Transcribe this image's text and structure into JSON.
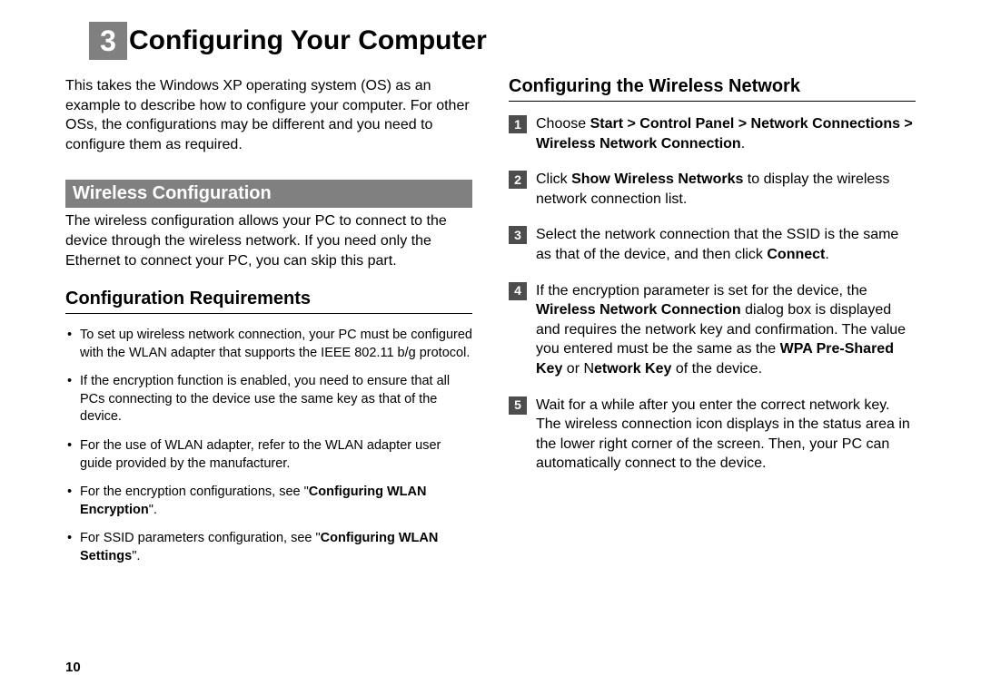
{
  "chapter": {
    "number": "3",
    "title": "Configuring Your Computer"
  },
  "intro": "This takes the Windows XP operating system (OS) as an example to describe how to configure your computer. For other OSs, the configurations may be different and you need to configure them as required.",
  "left": {
    "section_bar": "Wireless Configuration",
    "section_body": "The wireless configuration allows your PC to connect to the device through the wireless network. If you need only the Ethernet to connect your PC, you can skip this part.",
    "subhead": "Configuration Requirements",
    "bullets": {
      "b1": "To set up wireless network connection, your PC must be configured with the WLAN adapter that supports the IEEE 802.11 b/g protocol.",
      "b2": "If the encryption function is enabled, you need to ensure that all PCs connecting to the device use the same key as that of the device.",
      "b3": "For the use of WLAN adapter, refer to the WLAN adapter user guide provided by the manufacturer.",
      "b4_pre": "For the encryption configurations, see \"",
      "b4_bold": "Configuring WLAN Encryption",
      "b4_post": "\".",
      "b5_pre": "For SSID parameters configuration, see \"",
      "b5_bold": "Configuring WLAN Settings",
      "b5_post": "\"."
    }
  },
  "right": {
    "subhead": "Configuring the Wireless Network",
    "steps": {
      "s1_pre": "Choose ",
      "s1_bold": "Start > Control Panel > Network Connections > Wireless Network Connection",
      "s1_post": ".",
      "s2_pre": "Click ",
      "s2_bold": "Show Wireless Networks",
      "s2_post": " to display the wireless network connection list.",
      "s3_pre": "Select the network connection that the SSID is the same as that of the device, and then click ",
      "s3_bold": "Connect",
      "s3_post": ".",
      "s4_pre": "If the encryption parameter is set for the device, the ",
      "s4_b1": "Wireless Network Connection",
      "s4_mid1": " dialog box is displayed and requires the network key and confirmation. The value you entered must be the same as the ",
      "s4_b2": "WPA Pre-Shared Key",
      "s4_mid2": " or N",
      "s4_b3": "etwork Key",
      "s4_post": " of the device.",
      "s5": "Wait for a while after you enter the correct network key. The wireless connection icon displays in the status area in the lower right corner of the screen. Then, your PC can automatically connect to the device."
    },
    "nums": {
      "n1": "1",
      "n2": "2",
      "n3": "3",
      "n4": "4",
      "n5": "5"
    }
  },
  "page_number": "10"
}
